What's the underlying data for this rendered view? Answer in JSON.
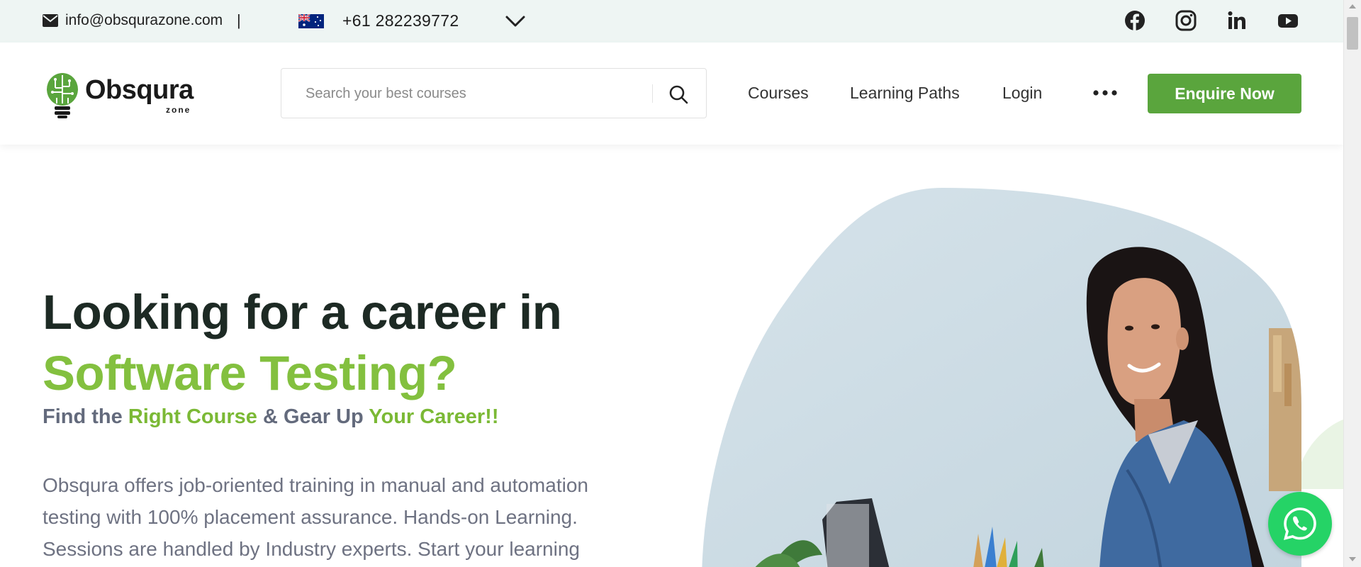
{
  "topbar": {
    "email": "info@obsqurazone.com",
    "separator": "|",
    "phone": "+61 282239772",
    "country_flag_icon": "australia-flag-icon",
    "social_icons": [
      "facebook-icon",
      "instagram-icon",
      "linkedin-icon",
      "youtube-icon"
    ]
  },
  "header": {
    "logo_brand": "Obsqura",
    "logo_sub": "zone",
    "search_placeholder": "Search your best courses",
    "nav": {
      "courses": "Courses",
      "learning_paths": "Learning Paths",
      "login": "Login"
    },
    "enquire_label": "Enquire Now"
  },
  "hero": {
    "title_line1": "Looking for a career in",
    "title_line2": "Software Testing?",
    "sub_part1": "Find the ",
    "sub_part2": "Right Course",
    "sub_part3": " & Gear Up ",
    "sub_part4": "Your Career!!",
    "description": "Obsqura offers job-oriented training in manual and automation testing with 100% placement assurance. Hands-on Learning. Sessions are handled by Industry experts. Start your learning"
  },
  "colors": {
    "topbar_bg": "#eef5f3",
    "brand_green": "#5aa53d",
    "accent_green": "#83c03f",
    "heading_dark": "#1d2a24",
    "whatsapp_green": "#25d366"
  }
}
